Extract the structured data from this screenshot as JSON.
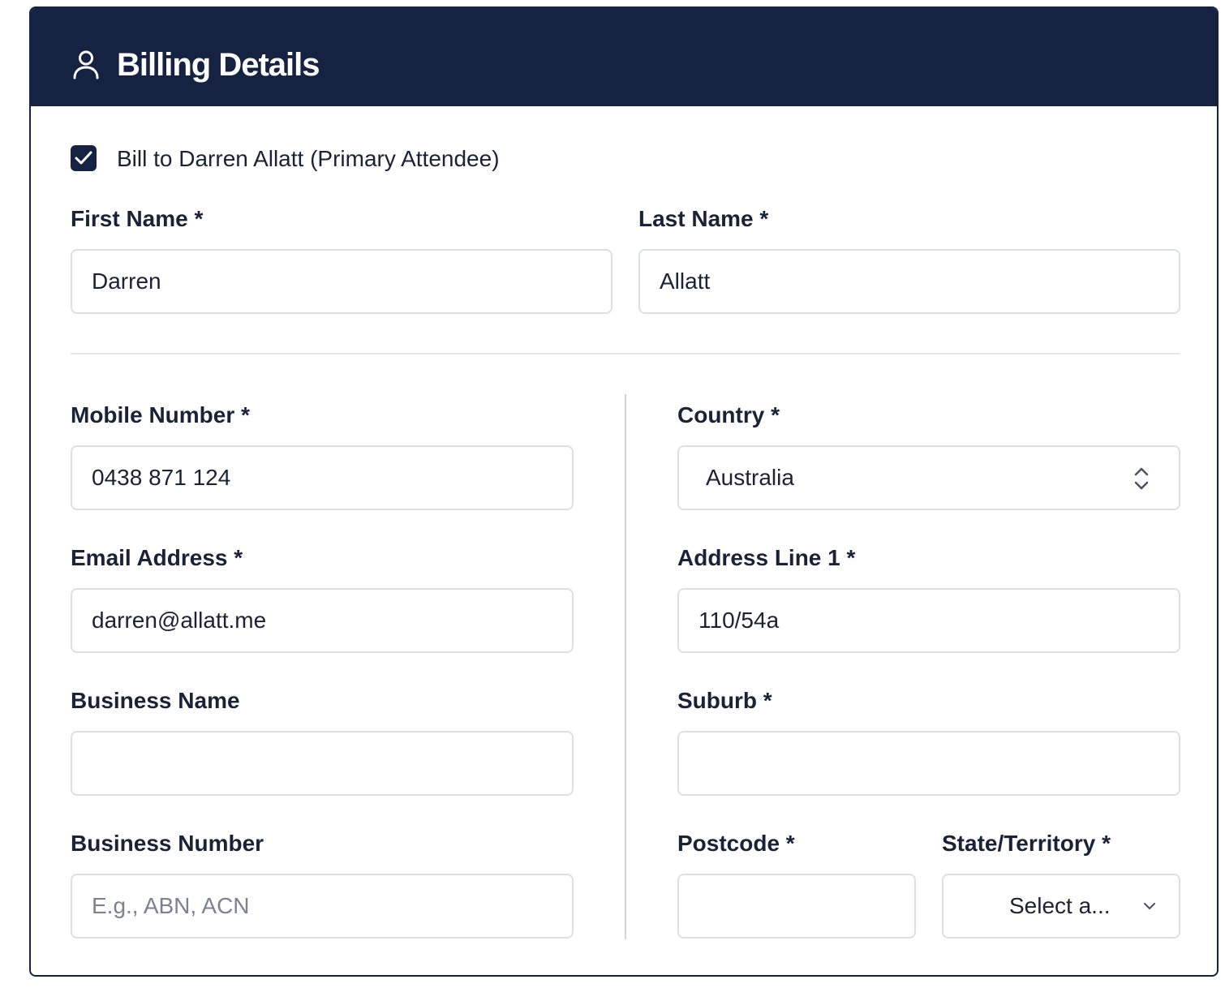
{
  "header": {
    "title": "Billing Details",
    "icon": "user-icon",
    "background": "#152241"
  },
  "bill_to": {
    "checked": true,
    "label": "Bill to Darren Allatt (Primary Attendee)"
  },
  "fields": {
    "first_name": {
      "label": "First Name *",
      "value": "Darren"
    },
    "last_name": {
      "label": "Last Name *",
      "value": "Allatt"
    },
    "mobile": {
      "label": "Mobile Number *",
      "value": "0438 871 124"
    },
    "email": {
      "label": "Email Address *",
      "value": "darren@allatt.me"
    },
    "business_name": {
      "label": "Business Name",
      "value": ""
    },
    "business_number": {
      "label": "Business Number",
      "value": "",
      "placeholder": "E.g., ABN, ACN"
    },
    "country": {
      "label": "Country *",
      "value": "Australia",
      "icon": "chevron-up-down-icon"
    },
    "address_line1": {
      "label": "Address Line 1 *",
      "value": "110/54a"
    },
    "suburb": {
      "label": "Suburb *",
      "value": ""
    },
    "postcode": {
      "label": "Postcode *",
      "value": ""
    },
    "state": {
      "label": "State/Territory *",
      "value": "Select a...",
      "icon": "chevron-down-icon"
    }
  }
}
